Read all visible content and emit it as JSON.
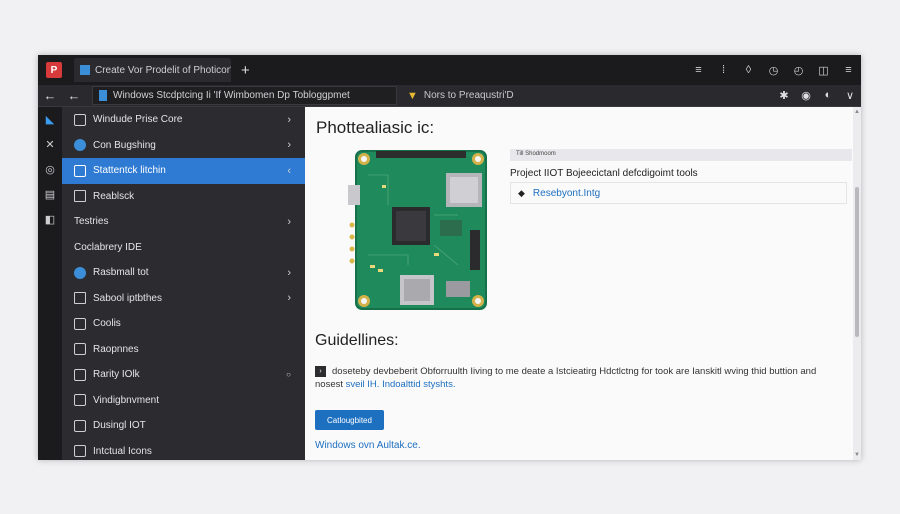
{
  "titlebar": {
    "app_logo": "P",
    "tab_title": "Create Vor Prodelit of Photicor's",
    "tab_close": "×",
    "new_tab": "+",
    "controls": [
      "≡",
      "⁞",
      "◊",
      "◷",
      "◴",
      "◫",
      "≡"
    ]
  },
  "navbar": {
    "back": "←",
    "back2": "←",
    "address": "Windows Stcdptcing Ii 'If Wimbomen Dp Tobloggpmet",
    "tab2_icon": "▼",
    "tab2_label": "Nors to Preaqustri'D",
    "right_icons": [
      "✱",
      "◉",
      "◐",
      "∨"
    ]
  },
  "rail": {
    "icons": [
      "◣",
      "✕",
      "◎",
      "▤",
      "◧"
    ]
  },
  "sidebar": {
    "items": [
      {
        "label": "Windude Prise Core",
        "icon": "▭",
        "chevron": "›"
      },
      {
        "label": "Con Bugshing",
        "icon": "●",
        "chevron": "›"
      },
      {
        "label": "Stattentck litchin",
        "icon": "▭",
        "chevron": "‹"
      },
      {
        "label": "Reablsck",
        "icon": "▭",
        "chevron": ""
      },
      {
        "label": "Testries",
        "icon": "",
        "chevron": "›"
      },
      {
        "label": "Coclabrery IDE",
        "icon": "◯",
        "chevron": ""
      },
      {
        "label": "Rasbmall tot",
        "icon": "●",
        "chevron": "›"
      },
      {
        "label": "Sabool iptbthes",
        "icon": "▭",
        "chevron": "›"
      },
      {
        "label": "Coolis",
        "icon": "▢",
        "chevron": ""
      },
      {
        "label": "Raopnnes",
        "icon": "▭",
        "chevron": ""
      },
      {
        "label": "Rarity IOlk",
        "icon": "▭",
        "chevron": "○"
      },
      {
        "label": "Vindigbnvment",
        "icon": "▭",
        "chevron": ""
      },
      {
        "label": "Dusingl IOT",
        "icon": "▭",
        "chevron": ""
      },
      {
        "label": "Intctual Icons",
        "icon": "▭",
        "chevron": ""
      }
    ]
  },
  "content": {
    "page_title": "Phottealiasic ic:",
    "panel_head": "Till Shodmoom",
    "panel_desc": "Project IIOT Bojeecictanl defcdigoimt tools",
    "panel_link": "Resebyont.Intg",
    "panel_link_icon": "◆",
    "guide_title": "Guidellines:",
    "guide_icon": "›",
    "guide_text": "doseteby devbeberit Obforruulth Iiving to me deate a Istcieatirg Hdctlctng for took are Ianskitl wving thid buttion and nosest",
    "guide_link": "sveil IH. Indoalttid styshts.",
    "button_label": "Catlougbited",
    "bottom_link": "Windows ovn Aultak.ce."
  },
  "colors": {
    "accent": "#2f7bd4",
    "link": "#1d6fc0",
    "board_green": "#1f8a5c"
  }
}
